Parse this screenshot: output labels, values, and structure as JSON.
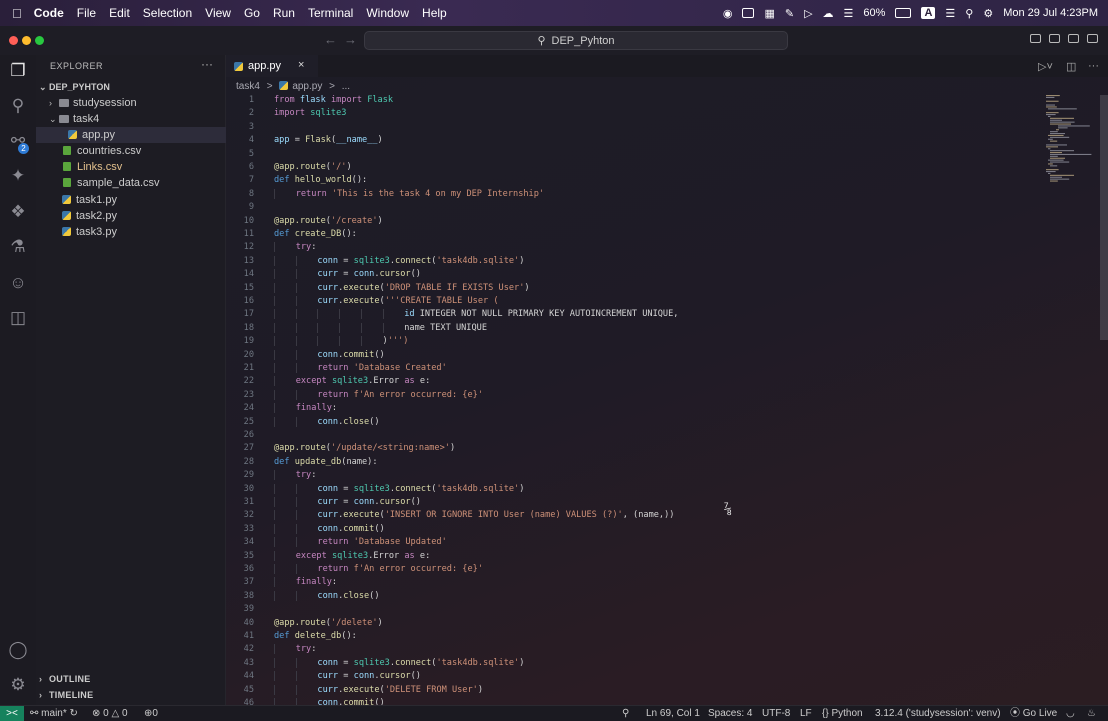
{
  "menubar": {
    "app": "Code",
    "items": [
      "File",
      "Edit",
      "Selection",
      "View",
      "Go",
      "Run",
      "Terminal",
      "Window",
      "Help"
    ],
    "battery": "60%",
    "input_indicator": "A",
    "clock": "Mon 29 Jul  4:23PM"
  },
  "titlebar": {
    "search_text": "DEP_Pyhton"
  },
  "activity": {
    "scm_badge": "2"
  },
  "sidebar": {
    "title": "EXPLORER",
    "more": "···",
    "root": "DEP_PYHTON",
    "items": [
      {
        "label": "studysession",
        "kind": "folder",
        "chevron": "›"
      },
      {
        "label": "task4",
        "kind": "folder",
        "chevron": "⌄"
      },
      {
        "label": "app.py",
        "kind": "py"
      },
      {
        "label": "countries.csv",
        "kind": "csv"
      },
      {
        "label": "Links.csv",
        "kind": "csv",
        "flag": "M"
      },
      {
        "label": "sample_data.csv",
        "kind": "csv"
      },
      {
        "label": "task1.py",
        "kind": "py"
      },
      {
        "label": "task2.py",
        "kind": "py"
      },
      {
        "label": "task3.py",
        "kind": "py"
      }
    ],
    "outline": "OUTLINE",
    "timeline": "TIMELINE"
  },
  "editor": {
    "tab_label": "app.py",
    "tab_close": "×",
    "breadcrumb": [
      "task4",
      ">",
      "app.py",
      ">",
      "..."
    ],
    "lines": [
      "from flask import Flask",
      "import sqlite3",
      "",
      "app = Flask(__name__)",
      "",
      "@app.route('/')",
      "def hello_world():",
      "    return 'This is the task 4 on my DEP Internship'",
      "",
      "@app.route('/create')",
      "def create_DB():",
      "    try:",
      "        conn = sqlite3.connect('task4db.sqlite')",
      "        curr = conn.cursor()",
      "        curr.execute('DROP TABLE IF EXISTS User')",
      "        curr.execute('''CREATE TABLE User (",
      "                        id INTEGER NOT NULL PRIMARY KEY AUTOINCREMENT UNIQUE,",
      "                        name TEXT UNIQUE",
      "                    )''')",
      "        conn.commit()",
      "        return 'Database Created'",
      "    except sqlite3.Error as e:",
      "        return f'An error occurred: {e}'",
      "    finally:",
      "        conn.close()",
      "",
      "@app.route('/update/<string:name>')",
      "def update_db(name):",
      "    try:",
      "        conn = sqlite3.connect('task4db.sqlite')",
      "        curr = conn.cursor()",
      "        curr.execute('INSERT OR IGNORE INTO User (name) VALUES (?)', (name,))",
      "        conn.commit()",
      "        return 'Database Updated'",
      "    except sqlite3.Error as e:",
      "        return f'An error occurred: {e}'",
      "    finally:",
      "        conn.close()",
      "",
      "@app.route('/delete')",
      "def delete_db():",
      "    try:",
      "        conn = sqlite3.connect('task4db.sqlite')",
      "        curr = conn.cursor()",
      "        curr.execute('DELETE FROM User')",
      "        conn.commit()"
    ]
  },
  "statusbar": {
    "remote": "><",
    "branch": "main*",
    "errors": "0",
    "warnings": "0",
    "ports": "0",
    "position": "Ln 69, Col 1",
    "spaces": "Spaces: 4",
    "encoding": "UTF-8",
    "eol": "LF",
    "language": "Python",
    "interpreter": "3.12.4 ('studysession': venv)",
    "golive": "Go Live"
  },
  "colors": {
    "accent": "#16825d",
    "badge": "#2e7bd6",
    "modified": "#e2c08d"
  }
}
